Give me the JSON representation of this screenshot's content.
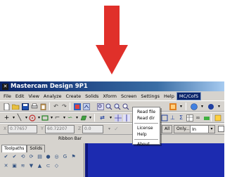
{
  "window": {
    "title": "Mastercam Design 9P1",
    "app_icon": "mastercam-x-icon"
  },
  "menubar": {
    "items": [
      "File",
      "Edit",
      "View",
      "Analyze",
      "Create",
      "Solids",
      "Xform",
      "Screen",
      "Settings",
      "Help",
      "MC/CofS"
    ],
    "active_item": "MC/CofS"
  },
  "dropdown": {
    "items": [
      {
        "label": "Read file"
      },
      {
        "label": "Read dir"
      },
      {
        "label": "License"
      },
      {
        "label": "Help"
      },
      {
        "label": "About"
      }
    ]
  },
  "toolbar3": {
    "x_value": "0.77657",
    "y_value": "60.72207",
    "z_value": "0.0",
    "button_all": "All",
    "button_only": "Only...",
    "combo_value": "In"
  },
  "ribbon": {
    "label": "Ribbon Bar"
  },
  "left_panel": {
    "tabs": [
      "Toolpaths",
      "Solids"
    ],
    "selected_tab": "Toolpaths"
  },
  "colors": {
    "annotation_arrow": "#e0302a",
    "title_bar_start": "#0a246a",
    "graphics_background": "#1c2bb0",
    "menu_highlight": "#0a246a"
  }
}
